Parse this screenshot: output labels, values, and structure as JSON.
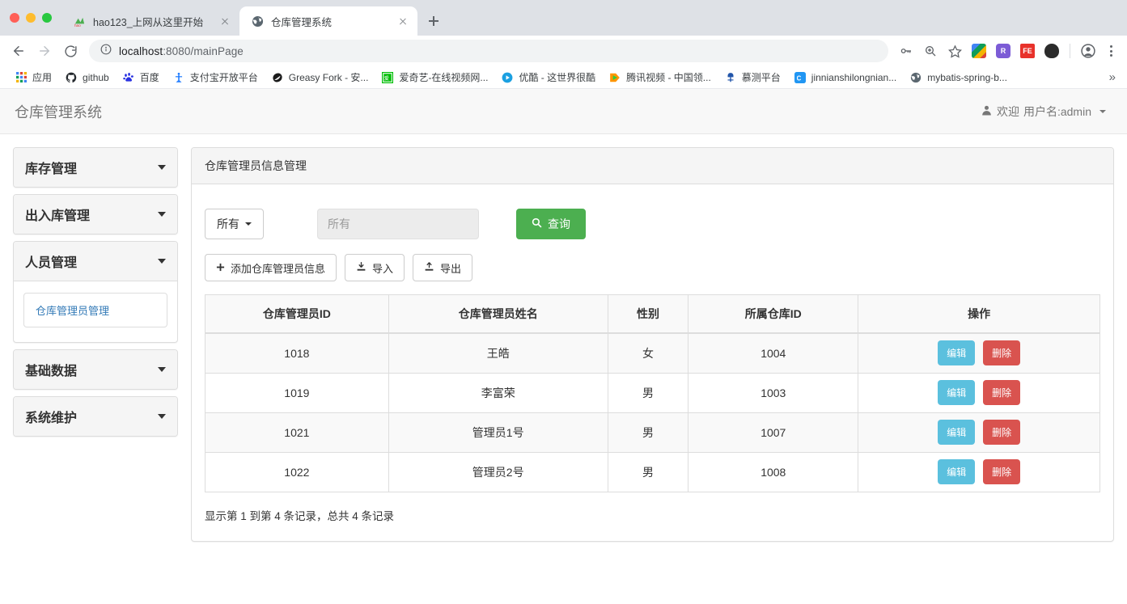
{
  "browser": {
    "tabs": [
      {
        "title": "hao123_上网从这里开始",
        "favicon": "hao123-icon",
        "active": false
      },
      {
        "title": "仓库管理系统",
        "favicon": "globe-icon",
        "active": true
      }
    ],
    "new_tab_label": "+",
    "omnibox": {
      "host": "localhost",
      "rest": ":8080/mainPage",
      "full_url": "localhost:8080/mainPage",
      "info_icon": "info-circle-icon"
    },
    "toolbar_icons": [
      "key-icon",
      "zoom-search-icon",
      "star-icon",
      "extension-colorful-icon",
      "extension-r-icon",
      "extension-fe-icon",
      "extension-dark-icon",
      "profile-avatar-icon",
      "kebab-menu-icon"
    ],
    "bookmarks": [
      {
        "label": "应用",
        "icon": "apps-grid-icon"
      },
      {
        "label": "github",
        "icon": "github-icon"
      },
      {
        "label": "百度",
        "icon": "baidu-icon"
      },
      {
        "label": "支付宝开放平台",
        "icon": "alipay-icon"
      },
      {
        "label": "Greasy Fork - 安...",
        "icon": "greasyfork-icon"
      },
      {
        "label": "爱奇艺-在线视频网...",
        "icon": "iqiyi-icon"
      },
      {
        "label": "优酷 - 这世界很酷",
        "icon": "youku-icon"
      },
      {
        "label": "腾讯视频 - 中国领...",
        "icon": "tencentvideo-icon"
      },
      {
        "label": "慕测平台",
        "icon": "muce-icon"
      },
      {
        "label": "jinnianshilongnian...",
        "icon": "csdn-icon"
      },
      {
        "label": "mybatis-spring-b...",
        "icon": "globe-icon"
      }
    ],
    "bookmarks_overflow": "»"
  },
  "app": {
    "brand": "仓库管理系统",
    "user": {
      "icon": "user-icon",
      "greeting": "欢迎",
      "name_label": "用户名:admin"
    },
    "sidebar": {
      "groups": [
        {
          "label": "库存管理",
          "expanded": false,
          "items": []
        },
        {
          "label": "出入库管理",
          "expanded": false,
          "items": []
        },
        {
          "label": "人员管理",
          "expanded": true,
          "items": [
            {
              "label": "仓库管理员管理",
              "active": true
            }
          ]
        },
        {
          "label": "基础数据",
          "expanded": false,
          "items": []
        },
        {
          "label": "系统维护",
          "expanded": false,
          "items": []
        }
      ]
    },
    "main": {
      "card_title": "仓库管理员信息管理",
      "filter": {
        "dropdown_label": "所有",
        "input_placeholder": "所有",
        "input_value": "",
        "search_label": "查询",
        "search_icon": "magnifier-icon"
      },
      "actions": [
        {
          "label": "添加仓库管理员信息",
          "icon": "plus-icon"
        },
        {
          "label": "导入",
          "icon": "import-icon"
        },
        {
          "label": "导出",
          "icon": "export-icon"
        }
      ],
      "table": {
        "columns": [
          "仓库管理员ID",
          "仓库管理员姓名",
          "性别",
          "所属仓库ID",
          "操作"
        ],
        "rows": [
          {
            "id": "1018",
            "name": "王皓",
            "gender": "女",
            "warehouse": "1004",
            "edit": "编辑",
            "delete": "删除"
          },
          {
            "id": "1019",
            "name": "李富荣",
            "gender": "男",
            "warehouse": "1003",
            "edit": "编辑",
            "delete": "删除"
          },
          {
            "id": "1021",
            "name": "管理员1号",
            "gender": "男",
            "warehouse": "1007",
            "edit": "编辑",
            "delete": "删除"
          },
          {
            "id": "1022",
            "name": "管理员2号",
            "gender": "男",
            "warehouse": "1008",
            "edit": "编辑",
            "delete": "删除"
          }
        ],
        "info": "显示第 1 到第 4 条记录，总共 4 条记录"
      }
    }
  },
  "colors": {
    "accent_green": "#4caf50",
    "edit_blue": "#5bc0de",
    "delete_red": "#d9534f",
    "link_blue": "#337ab7",
    "chrome_tabstrip": "#dee1e6"
  }
}
